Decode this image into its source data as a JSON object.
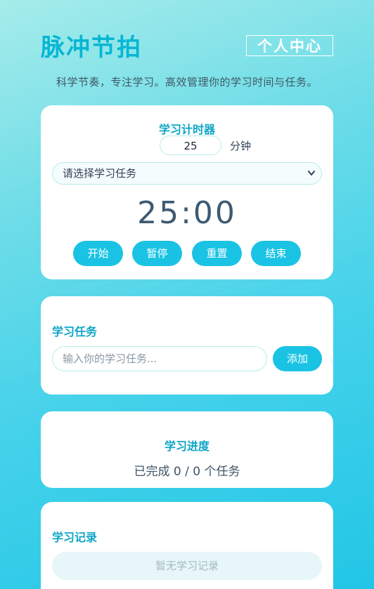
{
  "header": {
    "title": "脉冲节拍",
    "profile_label": "个人中心",
    "subtitle": "科学节奏，专注学习。高效管理你的学习时间与任务。"
  },
  "timer": {
    "title": "学习计时器",
    "minutes_value": "25",
    "minutes_unit": "分钟",
    "task_select_selected": "请选择学习任务",
    "display": "25:00",
    "buttons": {
      "start": "开始",
      "pause": "暂停",
      "reset": "重置",
      "end": "结束"
    }
  },
  "tasks": {
    "title": "学习任务",
    "input_placeholder": "输入你的学习任务...",
    "add_label": "添加"
  },
  "progress": {
    "title": "学习进度",
    "text": "已完成 0 / 0 个任务",
    "completed": 0,
    "total": 0
  },
  "records": {
    "title": "学习记录",
    "empty_text": "暂无学习记录"
  },
  "colors": {
    "accent": "#06b6d4",
    "button": "#1ac3e3",
    "card": "#ffffff"
  }
}
